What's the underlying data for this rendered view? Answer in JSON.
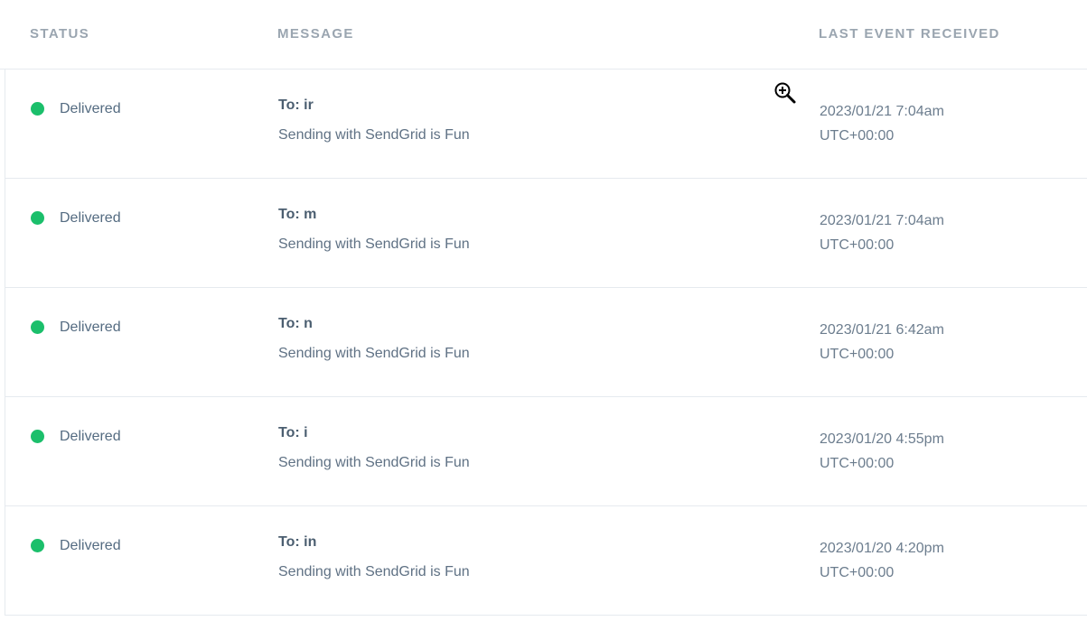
{
  "columns": {
    "status": "STATUS",
    "message": "MESSAGE",
    "last_event": "LAST EVENT RECEIVED"
  },
  "rows": [
    {
      "status": "Delivered",
      "to": "To: ir",
      "subject": "Sending with SendGrid is Fun",
      "date": "2023/01/21 7:04am",
      "tz": "UTC+00:00"
    },
    {
      "status": "Delivered",
      "to": "To: m",
      "subject": "Sending with SendGrid is Fun",
      "date": "2023/01/21 7:04am",
      "tz": "UTC+00:00"
    },
    {
      "status": "Delivered",
      "to": "To: n",
      "subject": "Sending with SendGrid is Fun",
      "date": "2023/01/21 6:42am",
      "tz": "UTC+00:00"
    },
    {
      "status": "Delivered",
      "to": "To: i",
      "subject": "Sending with SendGrid is Fun",
      "date": "2023/01/20 4:55pm",
      "tz": "UTC+00:00"
    },
    {
      "status": "Delivered",
      "to": "To: in",
      "subject": "Sending with SendGrid is Fun",
      "date": "2023/01/20 4:20pm",
      "tz": "UTC+00:00"
    }
  ],
  "colors": {
    "delivered": "#1bbf6b",
    "header_text": "#9aa5b0",
    "divider": "#e6eaef"
  },
  "icons": {
    "cursor": "zoom-in-icon",
    "status": "status-dot-icon"
  }
}
